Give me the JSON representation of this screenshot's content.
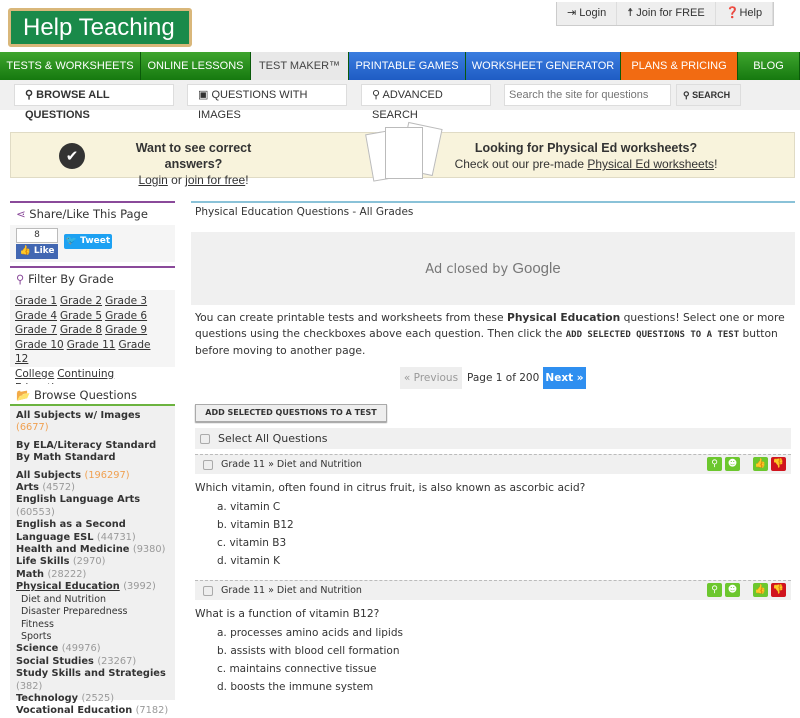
{
  "logo": "Help Teaching",
  "topbar": [
    "Login",
    "Join for FREE",
    "Help"
  ],
  "nav": [
    "TESTS & WORKSHEETS",
    "ONLINE LESSONS",
    "TEST MAKER™",
    "PRINTABLE GAMES",
    "WORKSHEET GENERATOR",
    "PLANS & PRICING",
    "BLOG"
  ],
  "subnav": {
    "browse": "BROWSE ALL QUESTIONS",
    "images": "QUESTIONS WITH IMAGES",
    "advanced": "ADVANCED SEARCH",
    "search_placeholder": "Search the site for questions",
    "search_btn": "SEARCH"
  },
  "banner": {
    "left_title": "Want to see correct answers?",
    "login": "Login",
    "or": " or ",
    "join": "join for free",
    "excl": "!",
    "right_title": "Looking for Physical Ed worksheets?",
    "right_pre": "Check out our pre-made ",
    "right_link": "Physical Ed worksheets",
    "right_post": "!"
  },
  "share": {
    "title": "Share/Like This Page",
    "count": "8",
    "like": "Like",
    "tweet": "Tweet"
  },
  "filter": {
    "title": "Filter By Grade",
    "grades": [
      "Grade 1",
      "Grade 2",
      "Grade 3",
      "Grade 4",
      "Grade 5",
      "Grade 6",
      "Grade 7",
      "Grade 8",
      "Grade 9",
      "Grade 10",
      "Grade 11",
      "Grade 12",
      "College",
      "Continuing Education"
    ]
  },
  "browse": {
    "title": "Browse Questions",
    "items": [
      {
        "label": "All Subjects w/ Images",
        "count": "(6677)"
      },
      {
        "label": "By ELA/Literacy Standard",
        "count": ""
      },
      {
        "label": "By Math Standard",
        "count": ""
      },
      {
        "label": "All Subjects",
        "count": "(196297)"
      },
      {
        "label": "Arts",
        "count": "(4572)"
      },
      {
        "label": "English Language Arts",
        "count": "(60553)"
      },
      {
        "label": "English as a Second Language ESL",
        "count": "(44731)"
      },
      {
        "label": "Health and Medicine",
        "count": "(9380)"
      },
      {
        "label": "Life Skills",
        "count": "(2970)"
      },
      {
        "label": "Math",
        "count": "(28222)"
      },
      {
        "label": "Physical Education",
        "count": "(3992)"
      },
      {
        "label": "Science",
        "count": "(49976)"
      },
      {
        "label": "Social Studies",
        "count": "(23267)"
      },
      {
        "label": "Study Skills and Strategies",
        "count": "(382)"
      },
      {
        "label": "Technology",
        "count": "(2525)"
      },
      {
        "label": "Vocational Education",
        "count": "(7182)"
      }
    ],
    "subitems": [
      "Diet and Nutrition",
      "Disaster Preparedness",
      "Fitness",
      "Sports"
    ]
  },
  "main": {
    "title": "Physical Education Questions - All Grades",
    "ad": "Ad closed by",
    "ad_brand": "Google",
    "desc_pre": "You can create printable tests and worksheets from these ",
    "desc_bold": "Physical Education",
    "desc_mid": " questions! Select one or more questions using the checkboxes above each question. Then click the ",
    "desc_code": "ADD SELECTED QUESTIONS TO A TEST",
    "desc_post": " button before moving to another page.",
    "prev": "« Previous",
    "page": "Page 1 of 200",
    "next": "Next »",
    "add_btn": "ADD SELECTED QUESTIONS TO A TEST",
    "select_all": "Select All Questions",
    "questions": [
      {
        "meta": "Grade 11 » Diet and Nutrition",
        "text": "Which vitamin, often found in citrus fruit, is also known as ascorbic acid?",
        "options": [
          "a. vitamin C",
          "b. vitamin B12",
          "c. vitamin B3",
          "d. vitamin K"
        ]
      },
      {
        "meta": "Grade 11 » Diet and Nutrition",
        "text": "What is a function of vitamin B12?",
        "options": [
          "a. processes amino acids and lipids",
          "b. assists with blood cell formation",
          "c. maintains connective tissue",
          "d. boosts the immune system"
        ]
      }
    ]
  },
  "colors": {
    "green": "#3ea52e",
    "blue": "#1f5cc4",
    "orange": "#f26b12",
    "purple": "#8a4a9a",
    "next": "#2f8ff0",
    "thumbdown": "#d0141e"
  }
}
